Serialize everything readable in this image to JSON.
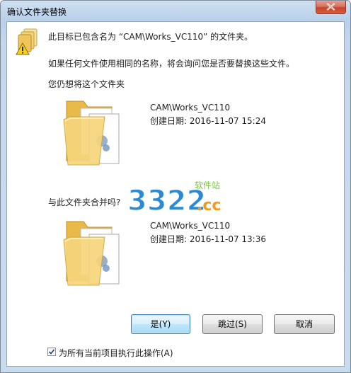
{
  "window": {
    "title": "确认文件夹替换"
  },
  "message": {
    "line1": "此目标已包含名为 “CAM\\Works_VC110” 的文件夹。",
    "line2": "如果任何文件使用相同的名称，将会询问您是否要替换这些文件。",
    "line3": "您仍想将这个文件夹"
  },
  "target_folder": {
    "name": "CAM\\Works_VC110",
    "created": "创建日期: 2016-11-07 15:24"
  },
  "merge_question": "与此文件夹合并吗?",
  "source_folder": {
    "name": "CAM\\Works_VC110",
    "created": "创建日期: 2016-11-07 13:36"
  },
  "buttons": {
    "yes": "是(Y)",
    "skip": "跳过(S)",
    "cancel": "取消"
  },
  "apply_all": {
    "label": "为所有当前项目执行此操作(A)",
    "checked": true
  },
  "watermark": {
    "digits": "3322",
    "suffix": ".cc",
    "tag": "软件站"
  },
  "icons": {
    "warning": "folder-warning-icon",
    "folder": "folder-icon",
    "close": "close-icon",
    "check": "checkmark-icon"
  },
  "colors": {
    "close_red": "#c7432b",
    "default_button_border": "#3c7fb1",
    "folder_yellow": "#f3d06b",
    "watermark_blue": "#2a8ad4",
    "watermark_green": "#7cc242",
    "watermark_orange": "#f39a1f"
  }
}
